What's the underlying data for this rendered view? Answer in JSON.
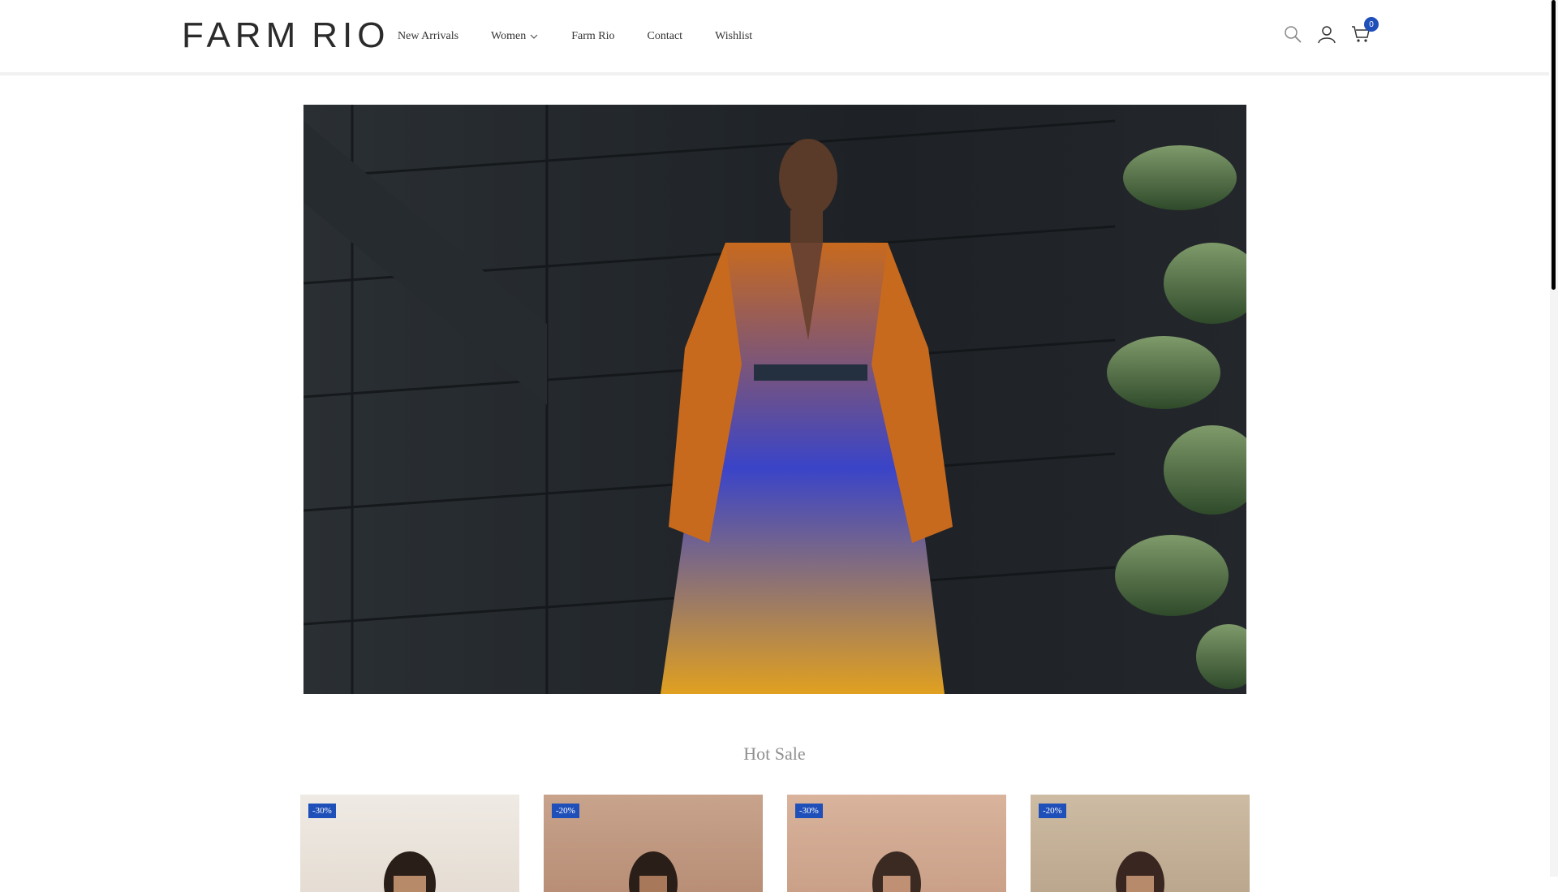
{
  "brand": {
    "logo_word1": "FARM",
    "logo_word2": "RIO"
  },
  "nav": {
    "items": [
      {
        "label": "New Arrivals",
        "has_dropdown": false
      },
      {
        "label": "Women",
        "has_dropdown": true
      },
      {
        "label": "Farm Rio",
        "has_dropdown": false
      },
      {
        "label": "Contact",
        "has_dropdown": false
      },
      {
        "label": "Wishlist",
        "has_dropdown": false
      }
    ]
  },
  "header_icons": {
    "search": "search-icon",
    "account": "user-icon",
    "cart": "cart-icon",
    "cart_count": "0"
  },
  "colors": {
    "accent": "#1f4fb8",
    "section_title": "#8f8f8f"
  },
  "hot_sale": {
    "title": "Hot Sale",
    "products": [
      {
        "badge": "-30%"
      },
      {
        "badge": "-20%"
      },
      {
        "badge": "-30%"
      },
      {
        "badge": "-20%"
      }
    ]
  }
}
